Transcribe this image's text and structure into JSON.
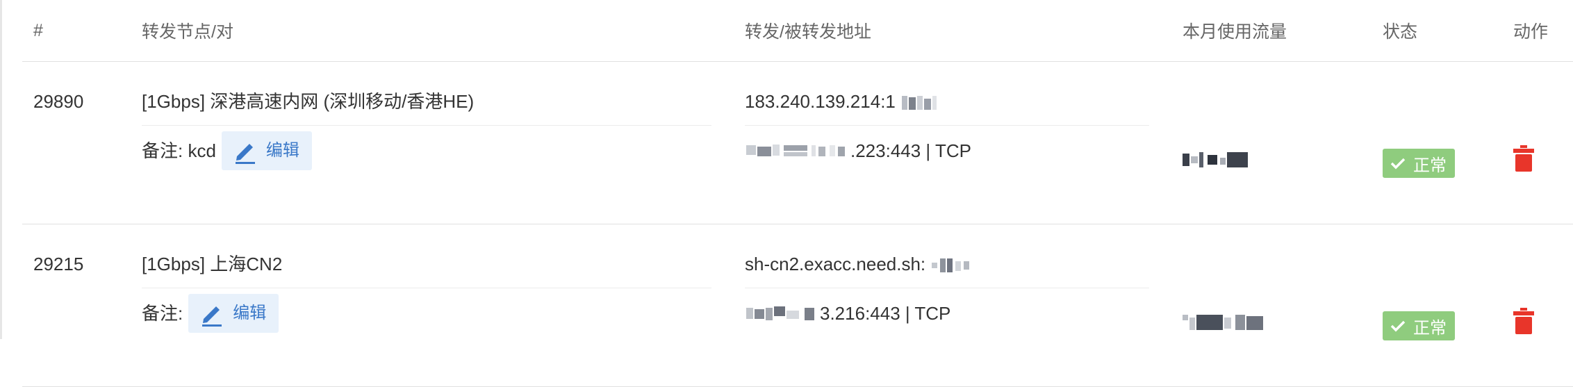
{
  "columns": {
    "id": "#",
    "node": "转发节点/对",
    "address": "转发/被转发地址",
    "traffic": "本月使用流量",
    "status": "状态",
    "action": "动作"
  },
  "rows": [
    {
      "id": "29890",
      "node": "[1Gbps] 深港高速内网 (深圳移动/香港HE)",
      "note_label": "备注: kcd",
      "edit_label": "编辑",
      "forward_addr": "183.240.139.214:1",
      "target_addr_tail": ".223:443 | TCP",
      "status": "正常"
    },
    {
      "id": "29215",
      "node": "[1Gbps] 上海CN2",
      "note_label": "备注:",
      "edit_label": "编辑",
      "forward_addr": "sh-cn2.exacc.need.sh:",
      "target_addr_tail": "3.216:443 | TCP",
      "status": "正常"
    }
  ],
  "colors": {
    "accent": "#3a78c8",
    "edit_bg": "#e8f1fb",
    "status_ok": "#8fcc7e",
    "delete": "#e8352a"
  },
  "icons": {
    "edit": "pencil-icon",
    "status": "check-icon",
    "delete": "trash-icon"
  }
}
